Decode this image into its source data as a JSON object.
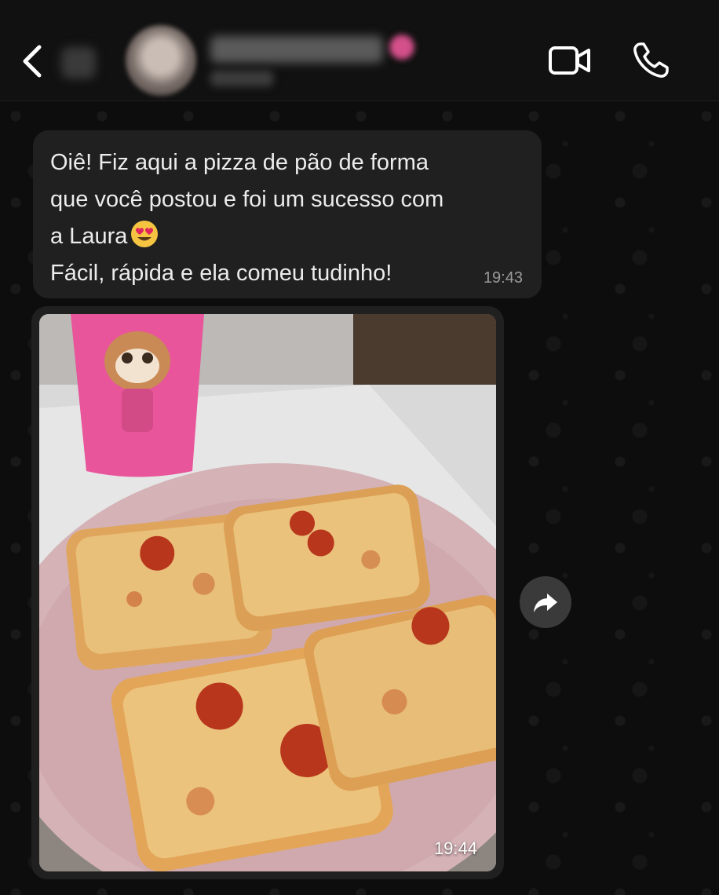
{
  "header": {
    "back_icon": "chevron-left-icon",
    "video_icon": "video-camera-icon",
    "call_icon": "phone-icon"
  },
  "messages": [
    {
      "type": "text",
      "lines": [
        "Oiê! Fiz aqui a pizza de pão de forma",
        "que você postou e foi um sucesso com",
        "a Laura",
        "Fácil, rápida e ela comeu tudinho!"
      ],
      "emoji": "smiling-face-with-heart-eyes",
      "time": "19:43"
    },
    {
      "type": "image",
      "alt_icon": "photo-pizza-toast",
      "time": "19:44",
      "forward_icon": "forward-arrow-icon"
    }
  ],
  "colors": {
    "bubble": "#202020",
    "header": "#111111",
    "background": "#0b0b0b"
  }
}
